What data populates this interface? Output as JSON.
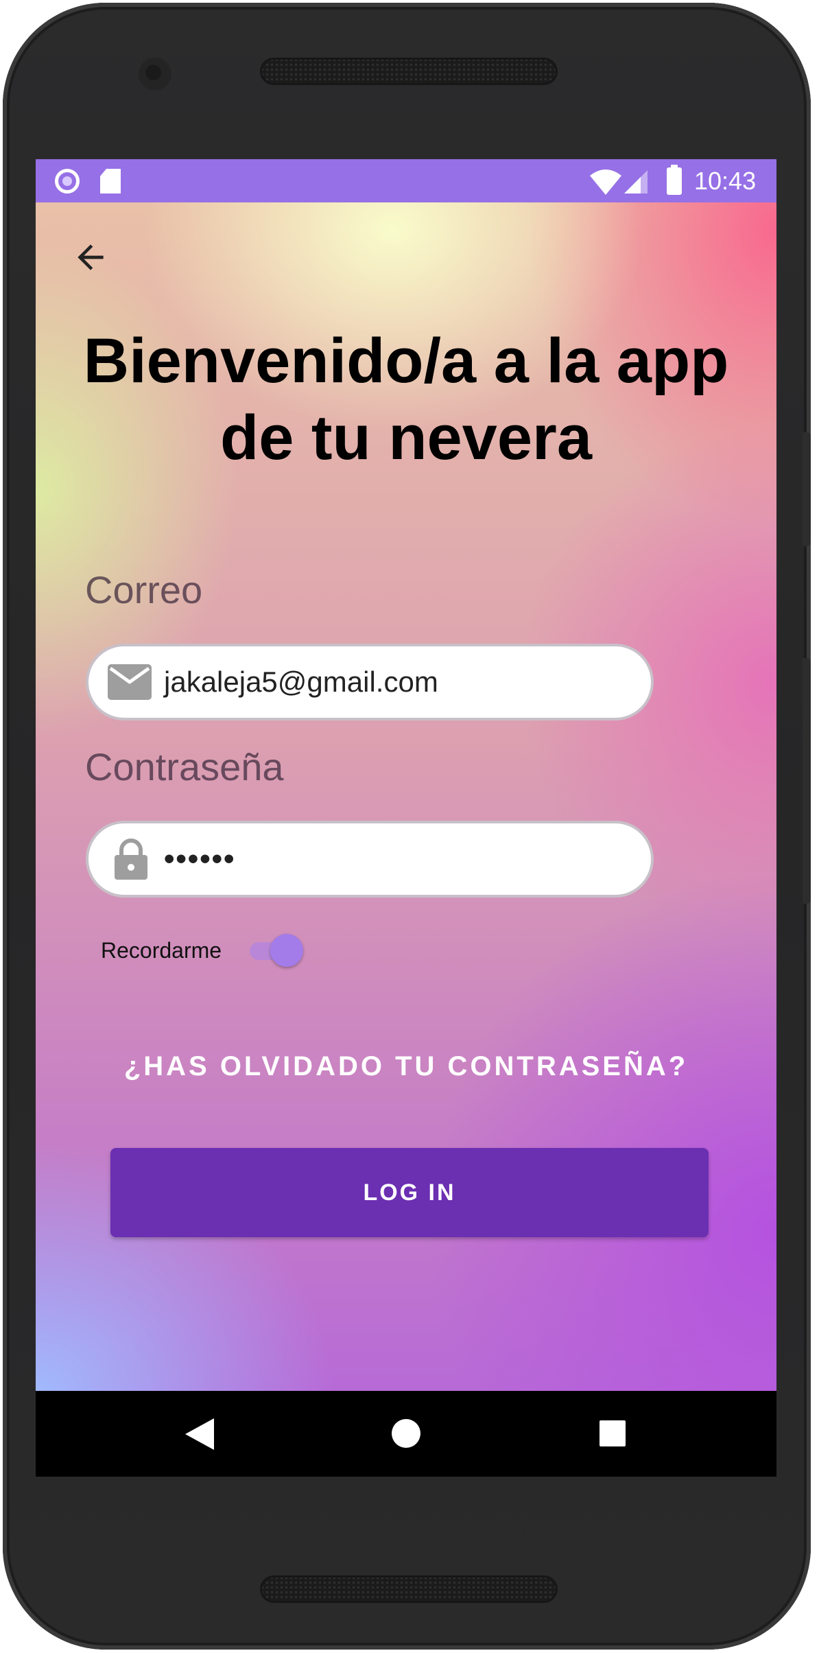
{
  "status_bar": {
    "time": "10:43",
    "left_icons": [
      "radio-icon",
      "sd-card-icon"
    ],
    "right_icons": [
      "wifi-icon",
      "signal-icon",
      "battery-icon"
    ]
  },
  "app_bar": {
    "back_icon": "arrow-back-icon"
  },
  "title": "Bienvenido/a a la app de tu nevera",
  "form": {
    "email_label": "Correo",
    "email_value": "jakaleja5@gmail.com",
    "email_icon": "mail-icon",
    "password_label": "Contraseña",
    "password_value": "••••••",
    "password_icon": "lock-icon",
    "remember_label": "Recordarme",
    "remember_on": true
  },
  "forgot_password_label": "¿HAS OLVIDADO TU CONTRASEÑA?",
  "login_button_label": "LOG IN",
  "colors": {
    "status_bar": "#9670e6",
    "primary_button": "#6b2fb2",
    "toggle_thumb": "#a47cea"
  },
  "nav_bar": {
    "icons": [
      "nav-back-icon",
      "nav-home-icon",
      "nav-recents-icon"
    ]
  }
}
